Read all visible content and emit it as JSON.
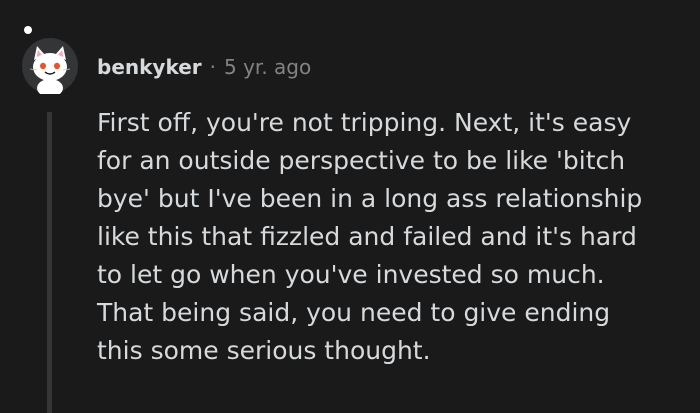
{
  "comment": {
    "author": "benkyker",
    "separator": "·",
    "timestamp": "5 yr. ago",
    "body_lines": [
      "First off, you're not tripping. Next, it's easy",
      "for an outside perspective to be like 'bitch",
      "bye' but I've been in a long ass relationship",
      "like this that fizzled and failed and it's hard",
      "to let go when you've invested so much.",
      "That being said, you need to give ending",
      "this some serious thought."
    ],
    "avatar_icon": "snoo-cat-avatar-icon"
  },
  "colors": {
    "background": "#1a1a1b",
    "text": "#d7dadc",
    "muted": "#818384",
    "thread_line": "#343536"
  }
}
